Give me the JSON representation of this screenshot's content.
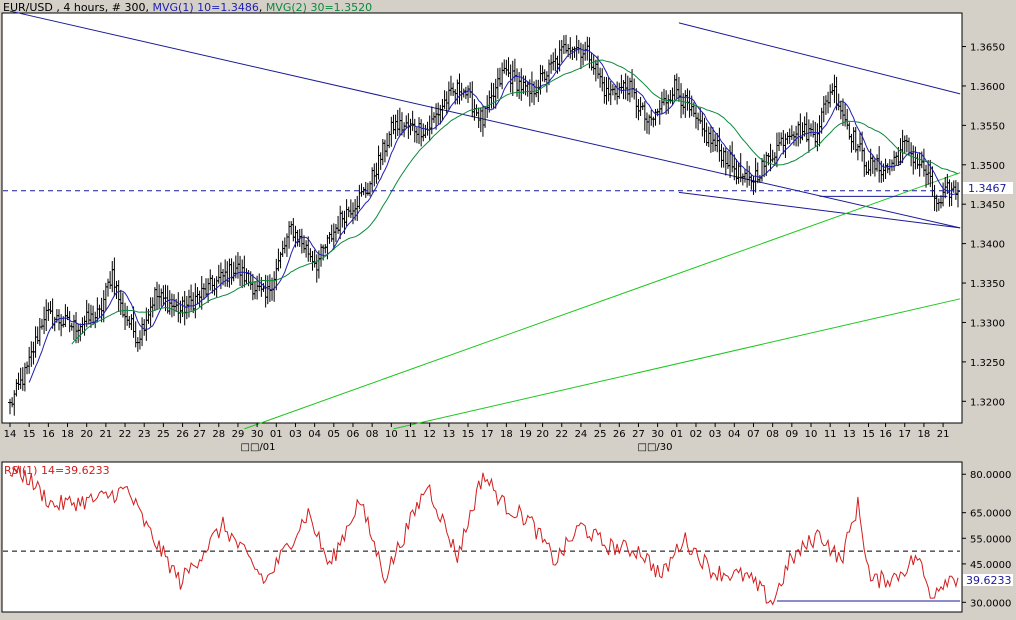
{
  "colors": {
    "frame_bg": "#d4d0c8",
    "plot_bg": "#ffffff",
    "bars": "#000000",
    "ma10": "#1e1eb4",
    "ma30": "#0a8a3c",
    "channel": "#1a1a96",
    "support": "#1ec81e",
    "dashed": "#1a1a96",
    "rsi": "#d21e1e",
    "price_tag": "#1a1a96"
  },
  "price_panel": {
    "symbol": "EUR/USD",
    "interval": "4 hours",
    "count": "# 300",
    "ma10_label": "MVG(1) 10=1.3486",
    "ma30_label": "MVG(2) 30=1.3520",
    "last_price_tag": "1.3467"
  },
  "x_axis": {
    "day_labels": [
      "14",
      "15",
      "16",
      "18",
      "20",
      "21",
      "22",
      "23",
      "25",
      "26",
      "27",
      "28",
      "29",
      "30",
      "01",
      "03",
      "04",
      "05",
      "06",
      "08",
      "10",
      "11",
      "12",
      "13",
      "15",
      "17",
      "18",
      "19",
      "20",
      "22",
      "24",
      "25",
      "26",
      "27",
      "30",
      "01",
      "02",
      "03",
      "04",
      "07",
      "08",
      "09",
      "10",
      "11",
      "13",
      "15",
      "16",
      "17",
      "18",
      "21"
    ],
    "month_labels": [
      "□□/01",
      "□□/30"
    ]
  },
  "rsi_panel": {
    "label": "RSI(1) 14=39.6233",
    "last_value_tag": "39.6233"
  },
  "chart_data": [
    {
      "type": "ohlc",
      "title": "EUR/USD , 4 hours, # 300",
      "ylim": [
        1.3175,
        1.369
      ],
      "y_ticks": [
        1.32,
        1.325,
        1.33,
        1.335,
        1.34,
        1.345,
        1.35,
        1.355,
        1.36,
        1.365
      ],
      "y_tick_labels": [
        "1.3200",
        "1.3250",
        "1.3300",
        "1.3350",
        "1.3400",
        "1.3450",
        "1.3500",
        "1.3550",
        "1.3600",
        "1.3650"
      ],
      "anchors_index_close": [
        [
          0,
          1.3195
        ],
        [
          8,
          1.324
        ],
        [
          16,
          1.331
        ],
        [
          30,
          1.3295
        ],
        [
          42,
          1.331
        ],
        [
          48,
          1.3365
        ],
        [
          52,
          1.332
        ],
        [
          60,
          1.328
        ],
        [
          68,
          1.3335
        ],
        [
          80,
          1.3315
        ],
        [
          94,
          1.3345
        ],
        [
          106,
          1.337
        ],
        [
          120,
          1.333
        ],
        [
          132,
          1.342
        ],
        [
          144,
          1.3375
        ],
        [
          156,
          1.3435
        ],
        [
          168,
          1.347
        ],
        [
          180,
          1.355
        ],
        [
          196,
          1.3545
        ],
        [
          204,
          1.358
        ],
        [
          212,
          1.36
        ],
        [
          222,
          1.3555
        ],
        [
          232,
          1.362
        ],
        [
          244,
          1.359
        ],
        [
          256,
          1.363
        ],
        [
          262,
          1.3655
        ],
        [
          272,
          1.364
        ],
        [
          280,
          1.359
        ],
        [
          290,
          1.36
        ],
        [
          300,
          1.355
        ],
        [
          312,
          1.36
        ],
        [
          324,
          1.3545
        ],
        [
          336,
          1.351
        ],
        [
          346,
          1.3475
        ],
        [
          354,
          1.35
        ],
        [
          366,
          1.3545
        ],
        [
          378,
          1.354
        ],
        [
          386,
          1.36
        ],
        [
          394,
          1.3545
        ],
        [
          402,
          1.35
        ],
        [
          412,
          1.3495
        ],
        [
          420,
          1.3525
        ],
        [
          430,
          1.349
        ],
        [
          436,
          1.3445
        ],
        [
          440,
          1.3467
        ]
      ],
      "series": [
        {
          "name": "MVG(1) 10",
          "period": 10,
          "last": 1.3486
        },
        {
          "name": "MVG(2) 30",
          "period": 30,
          "last": 1.352
        }
      ],
      "trendlines": [
        {
          "name": "upper channel line",
          "from": [
            0,
            1.3695
          ],
          "to": [
            446,
            1.342
          ]
        },
        {
          "name": "descending channel top",
          "from": [
            314,
            1.368
          ],
          "to": [
            446,
            1.359
          ]
        },
        {
          "name": "descending channel bottom",
          "from": [
            314,
            1.3465
          ],
          "to": [
            446,
            1.342
          ]
        },
        {
          "name": "support line 1",
          "from": [
            110,
            1.3165
          ],
          "to": [
            446,
            1.349
          ]
        },
        {
          "name": "support line 2",
          "from": [
            180,
            1.3165
          ],
          "to": [
            446,
            1.333
          ]
        },
        {
          "name": "horizontal support",
          "from": [
            380,
            1.346
          ],
          "to": [
            440,
            1.346
          ]
        }
      ],
      "dashed_level": 1.3467
    },
    {
      "type": "line",
      "title": "RSI(1) 14",
      "ylim": [
        27.0,
        84.0
      ],
      "y_ticks": [
        30,
        45,
        55,
        65,
        80
      ],
      "y_tick_labels": [
        "30.0000",
        "45.0000",
        "55.0000",
        "65.0000",
        "80.0000"
      ],
      "dashed_level": 50,
      "last": 39.6233,
      "anchors_index_value": [
        [
          0,
          82
        ],
        [
          8,
          79
        ],
        [
          20,
          68
        ],
        [
          40,
          70
        ],
        [
          55,
          74
        ],
        [
          65,
          58
        ],
        [
          80,
          38
        ],
        [
          100,
          60
        ],
        [
          120,
          38
        ],
        [
          140,
          65
        ],
        [
          150,
          44
        ],
        [
          164,
          70
        ],
        [
          176,
          40
        ],
        [
          196,
          76
        ],
        [
          210,
          48
        ],
        [
          222,
          80
        ],
        [
          232,
          68
        ],
        [
          244,
          62
        ],
        [
          256,
          46
        ],
        [
          268,
          60
        ],
        [
          280,
          52
        ],
        [
          296,
          50
        ],
        [
          306,
          40
        ],
        [
          316,
          55
        ],
        [
          330,
          42
        ],
        [
          346,
          40
        ],
        [
          358,
          30
        ],
        [
          366,
          46
        ],
        [
          380,
          57
        ],
        [
          390,
          46
        ],
        [
          398,
          68
        ],
        [
          404,
          38
        ],
        [
          416,
          40
        ],
        [
          426,
          48
        ],
        [
          432,
          33
        ],
        [
          440,
          39.6
        ]
      ],
      "horizontal_line": {
        "from": [
          360,
          30.5
        ],
        "to": [
          446,
          30.5
        ]
      }
    }
  ]
}
